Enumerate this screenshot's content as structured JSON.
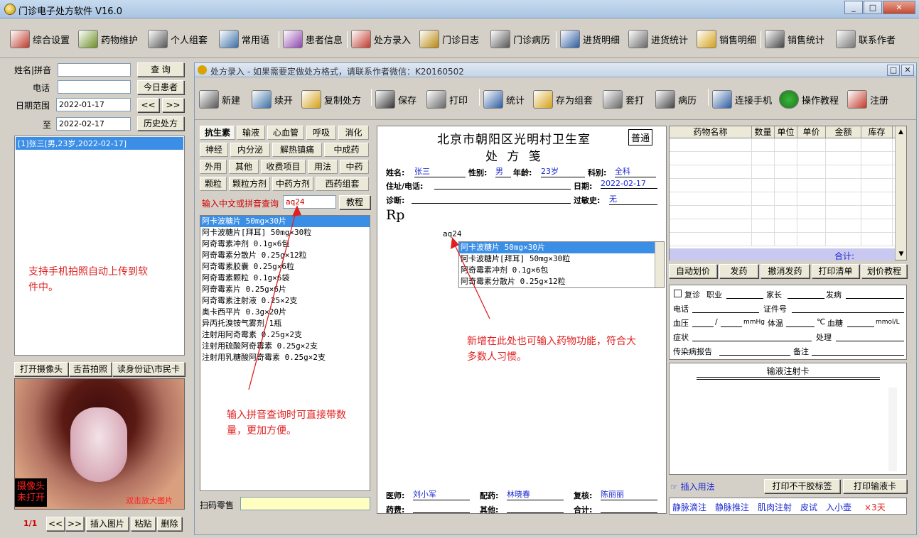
{
  "window": {
    "title": "门诊电子处方软件  V16.0",
    "min": "_",
    "max": "□",
    "close": "✕"
  },
  "toolbar": [
    {
      "label": "综合设置",
      "icon": "settings-disc-icon"
    },
    {
      "label": "药物维护",
      "icon": "pills-icon"
    },
    {
      "label": "个人组套",
      "icon": "stack-icon"
    },
    {
      "label": "常用语",
      "icon": "chart-edit-icon"
    },
    {
      "label": "患者信息",
      "icon": "patients-icon"
    },
    {
      "label": "处方录入",
      "icon": "prescription-icon"
    },
    {
      "label": "门诊日志",
      "icon": "log-icon"
    },
    {
      "label": "门诊病历",
      "icon": "record-icon"
    },
    {
      "label": "进货明细",
      "icon": "bar-chart-icon"
    },
    {
      "label": "进货统计",
      "icon": "line-chart-icon"
    },
    {
      "label": "销售明细",
      "icon": "sales-bar-icon"
    },
    {
      "label": "销售统计",
      "icon": "sales-line-icon"
    },
    {
      "label": "联系作者",
      "icon": "contact-icon"
    }
  ],
  "left": {
    "name_label": "姓名|拼音",
    "phone_label": "电话",
    "range_label": "日期范围",
    "to_label": "至",
    "date_from": "2022-01-17",
    "date_to": "2022-02-17",
    "query": "查  询",
    "today": "今日患者",
    "prev": "<<",
    "next": ">>",
    "history": "历史处方",
    "patients": [
      "[1]张三[男,23岁,2022-02-17]"
    ],
    "annotation": "支持手机拍照自动上传到软件中。",
    "cam_btn": "打开摄像头",
    "tongue_btn": "舌苔拍照",
    "id_btn": "读身份证\\市民卡",
    "cam_status": "摄像头未打开",
    "zoom_hint": "双击放大图片",
    "page": "1/1",
    "insert": "插入图片",
    "paste": "粘贴",
    "delete": "删除"
  },
  "child": {
    "title": "处方录入 - 如果需要定做处方格式，请联系作者微信：K20160502"
  },
  "ctool": [
    {
      "label": "新建",
      "icon": "new-icon"
    },
    {
      "label": "续开",
      "icon": "continue-icon"
    },
    {
      "label": "复制处方",
      "icon": "folder-icon"
    },
    {
      "label": "保存",
      "icon": "save-icon"
    },
    {
      "label": "打印",
      "icon": "print-icon"
    },
    {
      "label": "统计",
      "icon": "stats-icon"
    },
    {
      "label": "存为组套",
      "icon": "clipboard-icon"
    },
    {
      "label": "套打",
      "icon": "printer-icon"
    },
    {
      "label": "病历",
      "icon": "doc-icon"
    },
    {
      "label": "连接手机",
      "icon": "phone-icon"
    },
    {
      "label": "操作教程",
      "icon": "help-icon"
    },
    {
      "label": "注册",
      "icon": "register-icon"
    }
  ],
  "cats": [
    [
      "抗生素",
      "输液",
      "心血管",
      "呼吸",
      "消化"
    ],
    [
      "神经",
      "内分泌",
      "解热镇痛",
      "中成药"
    ],
    [
      "外用",
      "其他",
      "收费项目",
      "用法",
      "中药"
    ],
    [
      "颗粒",
      "颗粒方剂",
      "中药方剂",
      "西药组套"
    ]
  ],
  "search": {
    "label": "输入中文或拼音查询",
    "value": "aq24",
    "tutorial": "教程"
  },
  "druglist": [
    "阿卡波糖片 50mg×30片",
    "阿卡波糖片[拜耳] 50mg×30粒",
    "阿奇霉素冲剂 0.1g×6包",
    "阿奇霉素分散片 0.25g×12粒",
    "阿奇霉素胶囊 0.25g×6粒",
    "阿奇霉素颗粒 0.1g×6袋",
    "阿奇霉素片 0.25g×6片",
    "阿奇霉素注射液 0.25×2支",
    "奥卡西平片 0.3g×20片",
    "异丙托溴铵气雾剂 1瓶",
    "注射用阿奇霉素 0.25g×2支",
    "注射用硫酸阿奇霉素 0.25g×2支",
    "注射用乳糖酸阿奇霉素 0.25g×2支"
  ],
  "annot_pinyin": "输入拼音查询时可直接带数量，更加方便。",
  "scan_label": "扫码零售",
  "rx": {
    "hospital": "北京市朝阳区光明村卫生室",
    "form": "处 方 笺",
    "type": "普通",
    "name_l": "姓名:",
    "name": "张三",
    "sex_l": "性别:",
    "sex": "男",
    "age_l": "年龄:",
    "age": "23岁",
    "dept_l": "科别:",
    "dept": "全科",
    "addr_l": "住址/电话:",
    "date_l": "日期:",
    "date": "2022-02-17",
    "diag_l": "诊断:",
    "allergy_l": "过敏史:",
    "allergy": "无",
    "rp": "Rp",
    "typed": "aq24",
    "popup": [
      "阿卡波糖片 50mg×30片",
      "阿卡波糖片[拜耳] 50mg×30粒",
      "阿奇霉素冲剂 0.1g×6包",
      "阿奇霉素分散片 0.25g×12粒"
    ],
    "annot": "新增在此处也可输入药物功能，符合大多数人习惯。",
    "doctor_l": "医师:",
    "doctor": "刘小军",
    "disp_l": "配药:",
    "disp": "林晓春",
    "check_l": "复核:",
    "check": "陈丽丽",
    "fee_l": "药费:",
    "other_l": "其他:",
    "total_l": "合计:"
  },
  "grid": {
    "headers": [
      "药物名称",
      "数量",
      "单位",
      "单价",
      "金额",
      "库存"
    ],
    "total": "合计:"
  },
  "gridbtns": [
    "自动划价",
    "发药",
    "撤消发药",
    "打印清单",
    "划价教程"
  ],
  "info": {
    "revisit": "复诊",
    "job": "职业",
    "parent": "家长",
    "onset": "发病",
    "phone": "电话",
    "id": "证件号",
    "bp": "血压",
    "bp_sep": "/",
    "bp_unit": "mmHg",
    "temp": "体温",
    "temp_unit": "℃",
    "sugar": "血糖",
    "sugar_unit": "mmol/L",
    "symptom": "症状",
    "treat": "处理",
    "infect": "传染病报告",
    "note": "备注"
  },
  "infusion": {
    "title": "输液注射卡",
    "insert": "插入用法",
    "print_label": "打印不干胶标签",
    "print_card": "打印输液卡",
    "routes": [
      "静脉滴注",
      "静脉推注",
      "肌肉注射",
      "皮试",
      "入小壶"
    ],
    "days": "×3天"
  }
}
